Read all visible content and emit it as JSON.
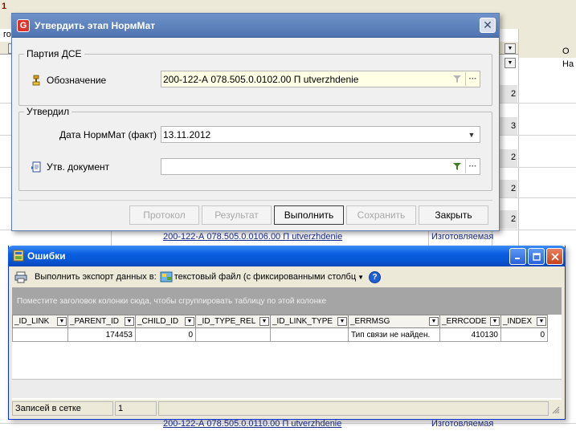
{
  "background": {
    "corner_label": "1",
    "corner_label2": "го",
    "header_o": "О",
    "header_na": "На",
    "row_numbers": [
      "2",
      "3",
      "2",
      "2",
      "2",
      "2"
    ],
    "link_rows": [
      {
        "text": "200-122-А 078.505.0.0106.00 П utverzhdenie",
        "type": "Изготовляемая"
      },
      {
        "text": "200-122-А 078.505.0.0110.00 П utverzhdenie",
        "type": "Изготовляемая"
      }
    ]
  },
  "dialog1": {
    "title": "Утвердить этап НормМат",
    "logo_letter": "G",
    "close_glyph": "✕",
    "group1": {
      "legend": "Партия ДСЕ",
      "designation_label": "Обозначение",
      "designation_value": "200-122-А 078.505.0.0102.00 П utverzhdenie"
    },
    "group2": {
      "legend": "Утвердил",
      "date_label": "Дата НормМат (факт)",
      "date_value": "13.11.2012",
      "doc_label": "Утв. документ",
      "doc_value": ""
    },
    "buttons": {
      "protocol": "Протокол",
      "result": "Результат",
      "execute": "Выполнить",
      "save": "Сохранить",
      "close": "Закрыть"
    }
  },
  "dialog2": {
    "title": "Ошибки",
    "toolbar": {
      "export_label": "Выполнить экспорт данных в:",
      "export_format": "текстовый файл (с фиксированными столбц"
    },
    "group_hint": "Поместите заголовок колонки сюда, чтобы сгруппировать таблицу по этой колонке",
    "columns": [
      "_ID_LINK",
      "_PARENT_ID",
      "_CHILD_ID",
      "_ID_TYPE_REL",
      "_ID_LINK_TYPE",
      "_ERRMSG",
      "_ERRCODE",
      "_INDEX"
    ],
    "rows": [
      [
        "",
        "174453",
        "0",
        "",
        "",
        "Тип связи не найден.",
        "410130",
        "0"
      ]
    ],
    "status": {
      "records_label": "Записей в сетке",
      "records_count": "1"
    }
  }
}
